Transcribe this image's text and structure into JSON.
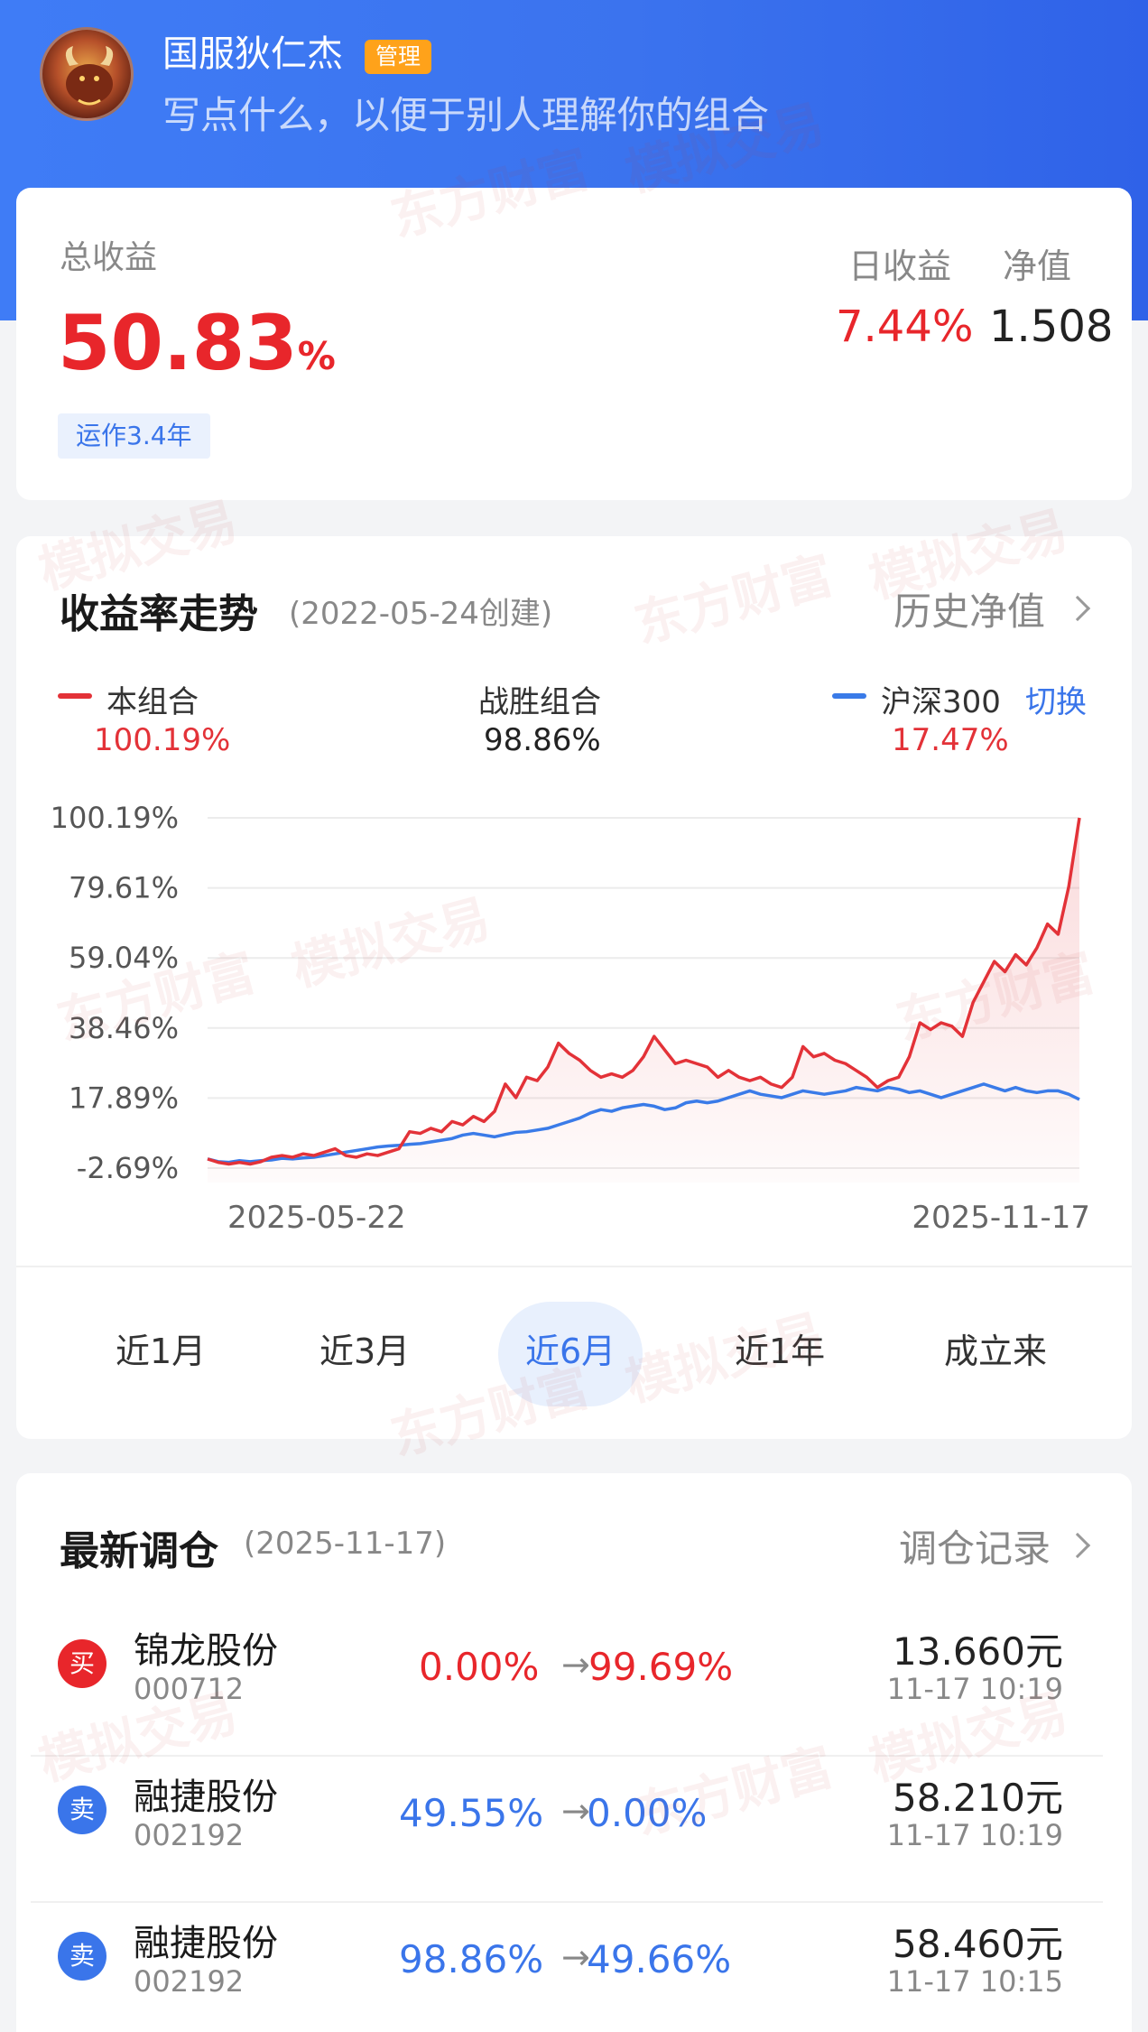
{
  "header": {
    "user_name": "国服狄仁杰",
    "role_badge": "管理",
    "description_placeholder": "写点什么，以便于别人理解你的组合"
  },
  "summary": {
    "total_label": "总收益",
    "total_value": "50.83",
    "total_unit": "%",
    "age_tag": "运作3.4年",
    "day_label": "日收益",
    "day_value": "7.44%",
    "nav_label": "净值",
    "nav_value": "1.508"
  },
  "trend": {
    "title": "收益率走势",
    "created": "(2022-05-24创建)",
    "history_link": "历史净值",
    "legend": {
      "portfolio_label": "本组合",
      "portfolio_value": "100.19%",
      "beat_label": "战胜组合",
      "beat_value": "98.86%",
      "index_label": "沪深300",
      "index_value": "17.47%",
      "switch_label": "切换"
    },
    "tabs": [
      "近1月",
      "近3月",
      "近6月",
      "近1年",
      "成立来"
    ],
    "active_tab": 2
  },
  "chart_data": {
    "type": "line",
    "x_start_label": "2025-05-22",
    "x_end_label": "2025-11-17",
    "y_tick_labels": [
      "100.19%",
      "79.61%",
      "59.04%",
      "38.46%",
      "17.89%",
      "-2.69%"
    ],
    "ylim": [
      -2.69,
      100.19
    ],
    "grid": true,
    "legend_position": "top",
    "series": [
      {
        "name": "本组合",
        "color": "#e33238",
        "values": [
          0.0,
          -1.0,
          -1.5,
          -1.0,
          -1.5,
          -0.8,
          0.5,
          1.0,
          0.5,
          1.5,
          1.0,
          2.0,
          3.0,
          1.0,
          0.5,
          1.5,
          1.0,
          2.0,
          3.0,
          8.0,
          7.5,
          9.0,
          8.0,
          11.0,
          10.0,
          12.5,
          11.0,
          14.0,
          22.0,
          18.0,
          24.0,
          23.0,
          27.0,
          34.0,
          31.0,
          29.0,
          26.0,
          24.0,
          25.0,
          24.0,
          26.0,
          30.0,
          36.0,
          32.0,
          28.0,
          29.0,
          28.0,
          27.0,
          24.0,
          26.0,
          24.0,
          23.0,
          24.0,
          22.0,
          21.0,
          24.0,
          33.0,
          30.0,
          31.0,
          29.0,
          28.0,
          26.0,
          24.0,
          21.0,
          23.0,
          24.0,
          30.0,
          40.0,
          38.0,
          40.0,
          39.0,
          36.0,
          46.0,
          52.0,
          58.0,
          55.0,
          60.0,
          57.0,
          62.0,
          69.0,
          66.0,
          80.0,
          100.19
        ]
      },
      {
        "name": "沪深300",
        "color": "#3a7be8",
        "values": [
          0.0,
          -0.8,
          -1.0,
          -0.5,
          -0.8,
          -0.5,
          -0.3,
          0.2,
          0.0,
          0.3,
          0.5,
          1.0,
          1.5,
          2.0,
          2.5,
          3.0,
          3.5,
          3.8,
          4.0,
          4.3,
          4.5,
          5.0,
          5.5,
          6.0,
          7.0,
          7.5,
          7.0,
          6.5,
          7.2,
          7.8,
          8.0,
          8.5,
          9.0,
          10.0,
          11.0,
          12.0,
          13.5,
          14.5,
          14.0,
          15.0,
          15.5,
          16.0,
          15.5,
          14.5,
          15.0,
          16.5,
          17.0,
          16.5,
          17.0,
          18.0,
          19.0,
          20.0,
          19.0,
          18.5,
          18.0,
          19.0,
          20.0,
          19.5,
          19.0,
          19.5,
          20.0,
          21.0,
          20.5,
          20.0,
          21.0,
          20.5,
          19.5,
          20.0,
          19.0,
          18.0,
          19.0,
          20.0,
          21.0,
          22.0,
          21.0,
          20.0,
          21.0,
          20.0,
          19.5,
          20.0,
          20.0,
          19.0,
          17.47
        ]
      }
    ]
  },
  "rebalance": {
    "title": "最新调仓",
    "date": "(2025-11-17)",
    "history_link": "调仓记录",
    "rows": [
      {
        "action": "买",
        "name": "锦龙股份",
        "code": "000712",
        "from": "0.00%",
        "to": "99.69%",
        "price": "13.660元",
        "time": "11-17  10:19",
        "color": "#e8262b"
      },
      {
        "action": "卖",
        "name": "融捷股份",
        "code": "002192",
        "from": "49.55%",
        "to": "0.00%",
        "price": "58.210元",
        "time": "11-17  10:19",
        "color": "#3a75ea"
      },
      {
        "action": "卖",
        "name": "融捷股份",
        "code": "002192",
        "from": "98.86%",
        "to": "49.66%",
        "price": "58.460元",
        "time": "11-17  10:15",
        "color": "#3a75ea"
      }
    ]
  },
  "watermark": {
    "brand": "东方财富",
    "mode": "模拟交易"
  }
}
